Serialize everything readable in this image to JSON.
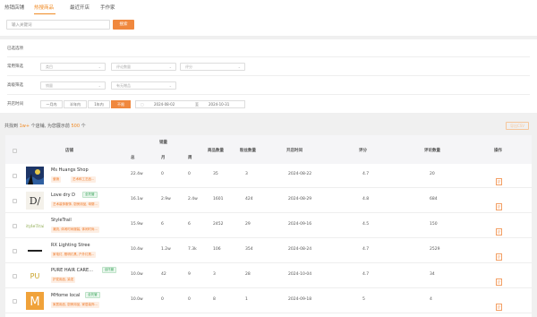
{
  "tabs": [
    "热销店铺",
    "热搜商品",
    "最近开店",
    "手作家"
  ],
  "search": {
    "placeholder": "输入关键词",
    "button": "搜索"
  },
  "filters": {
    "selected_label": "已选选项",
    "common_label": "常用筛选",
    "common_selects": [
      "类目",
      "评论数量",
      "评分"
    ],
    "advanced_label": "高级筛选",
    "advanced_selects": [
      "销量",
      "有无赠品"
    ],
    "time_label": "开店时间",
    "time_options": [
      "一月内",
      "半年内",
      "1年内",
      "不限"
    ],
    "time_active": "不限",
    "date_from": "2024-08-02",
    "date_to": "2024-10-31",
    "date_sep": "至"
  },
  "summary": {
    "prefix": "共找到",
    "count": "1w+",
    "mid": "个店铺, 为您展示前",
    "shown": "500",
    "suffix": "个"
  },
  "export_label": "导出CSV",
  "table": {
    "sales_group": "销量",
    "headers": {
      "shop": "店铺",
      "total": "总",
      "month": "月",
      "week": "周",
      "products": "商品数量",
      "followers": "粉丝数量",
      "opened": "开店时间",
      "rating": "评分",
      "reviews": "评论数量",
      "actions": "操作"
    },
    "rows": [
      {
        "name": "Ms Huangs Shop",
        "badge": "",
        "tags": [
          "营销",
          "艺术和工艺品..."
        ],
        "total": "22.4w",
        "month": "0",
        "week": "0",
        "products": "35",
        "followers": "3",
        "opened": "2024-08-22",
        "rating": "4.7",
        "reviews": "20"
      },
      {
        "name": "Love dry D",
        "badge": "全托管",
        "tags": [
          "艺术装饰服饰, 厨房用品, 母婴..."
        ],
        "total": "16.1w",
        "month": "2.9w",
        "week": "2.4w",
        "products": "1601",
        "followers": "424",
        "opened": "2024-08-29",
        "rating": "4.8",
        "reviews": "684"
      },
      {
        "name": "StyleTrail",
        "badge": "",
        "tags": [
          "潮流, 体闲时尚服装, 体闲时尚..."
        ],
        "total": "15.9w",
        "month": "6",
        "week": "6",
        "products": "2452",
        "followers": "29",
        "opened": "2024-09-16",
        "rating": "4.5",
        "reviews": "150"
      },
      {
        "name": "RX Lighting Stree",
        "badge": "",
        "tags": [
          "家电灯, 照明灯具, 户外灯具..."
        ],
        "total": "10.4w",
        "month": "1.2w",
        "week": "7.3k",
        "products": "106",
        "followers": "354",
        "opened": "2024-08-24",
        "rating": "4.7",
        "reviews": "2529"
      },
      {
        "name": "PURE HAIR CARE...",
        "badge": "全托管",
        "tags": [
          "护发用品, 染发"
        ],
        "total": "10.0w",
        "month": "42",
        "week": "9",
        "products": "3",
        "followers": "28",
        "opened": "2024-10-04",
        "rating": "4.7",
        "reviews": "34"
      },
      {
        "name": "MHome local",
        "badge": "全托管",
        "tags": [
          "家居用品, 厨房用品, 家居装饰..."
        ],
        "total": "10.0w",
        "month": "0",
        "week": "0",
        "products": "8",
        "followers": "1",
        "opened": "2024-09-18",
        "rating": "5",
        "reviews": "4"
      }
    ]
  },
  "colors": {
    "accent": "#f0883e",
    "badge_green": "#3aa35a",
    "tag_orange": "#ef7b2c"
  },
  "icons": [
    "chevron-down-icon",
    "sort-icon",
    "document-icon",
    "calendar-icon"
  ]
}
